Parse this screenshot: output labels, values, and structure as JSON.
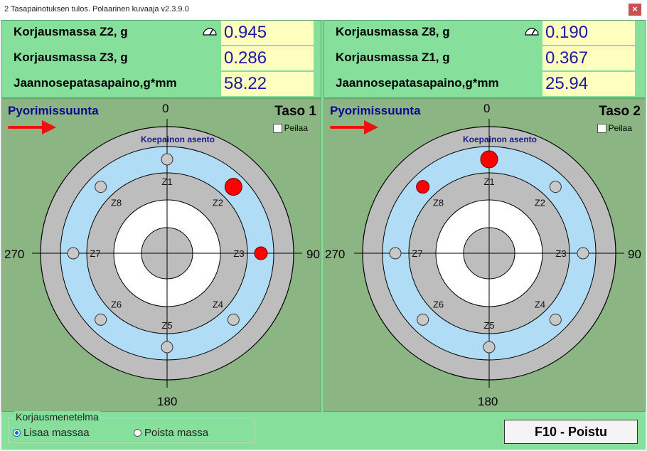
{
  "window": {
    "title": "2 Tasapainotuksen tulos. Polaarinen kuvaaja v2.3.9.0",
    "close_glyph": "×"
  },
  "results_left": {
    "rows": [
      {
        "label": "Korjausmassa Z2, g",
        "value": "0.945",
        "icon": "balance-gauge-icon"
      },
      {
        "label": "Korjausmassa Z3, g",
        "value": "0.286"
      },
      {
        "label": "Jaannosepatasapaino,g*mm",
        "value": "58.22"
      }
    ]
  },
  "results_right": {
    "rows": [
      {
        "label": "Korjausmassa Z8, g",
        "value": "0.190",
        "icon": "balance-gauge-icon"
      },
      {
        "label": "Korjausmassa Z1, g",
        "value": "0.367"
      },
      {
        "label": "Jaannosepatasapaino,g*mm",
        "value": "25.94"
      }
    ]
  },
  "plane1": {
    "rotation_label": "Pyorimissuunta",
    "plane_label": "Taso 1",
    "mirror_label": "Peilaa",
    "mirror_checked": false,
    "trial_weight_label": "Koepainon asento",
    "angles": {
      "top": "0",
      "right": "90",
      "bottom": "180",
      "left": "270"
    },
    "zones": [
      "Z1",
      "Z2",
      "Z3",
      "Z4",
      "Z5",
      "Z6",
      "Z7",
      "Z8"
    ],
    "correction_points": [
      {
        "zone": "Z2",
        "size": "large"
      },
      {
        "zone": "Z3",
        "size": "small"
      }
    ]
  },
  "plane2": {
    "rotation_label": "Pyorimissuunta",
    "plane_label": "Taso 2",
    "mirror_label": "Peilaa",
    "mirror_checked": false,
    "trial_weight_label": "Koepainon asento",
    "angles": {
      "top": "0",
      "right": "90",
      "bottom": "180",
      "left": "270"
    },
    "zones": [
      "Z1",
      "Z2",
      "Z3",
      "Z4",
      "Z5",
      "Z6",
      "Z7",
      "Z8"
    ],
    "correction_points": [
      {
        "zone": "Z1",
        "size": "large"
      },
      {
        "zone": "Z8",
        "size": "small"
      }
    ]
  },
  "method": {
    "title": "Korjausmenetelma",
    "options": [
      {
        "label": "Lisaa massaa",
        "selected": true
      },
      {
        "label": "Poista massa",
        "selected": false
      }
    ]
  },
  "exit_button": {
    "label": "F10 - Poistu"
  },
  "colors": {
    "panel_green": "#86df9a",
    "plot_bg": "#8bb583",
    "value_bg": "#ffffc0",
    "value_text": "#1a1aa0",
    "point_red": "#ff0000",
    "arrow_red": "#ee1111",
    "ring_blue": "#b0dcf6"
  }
}
